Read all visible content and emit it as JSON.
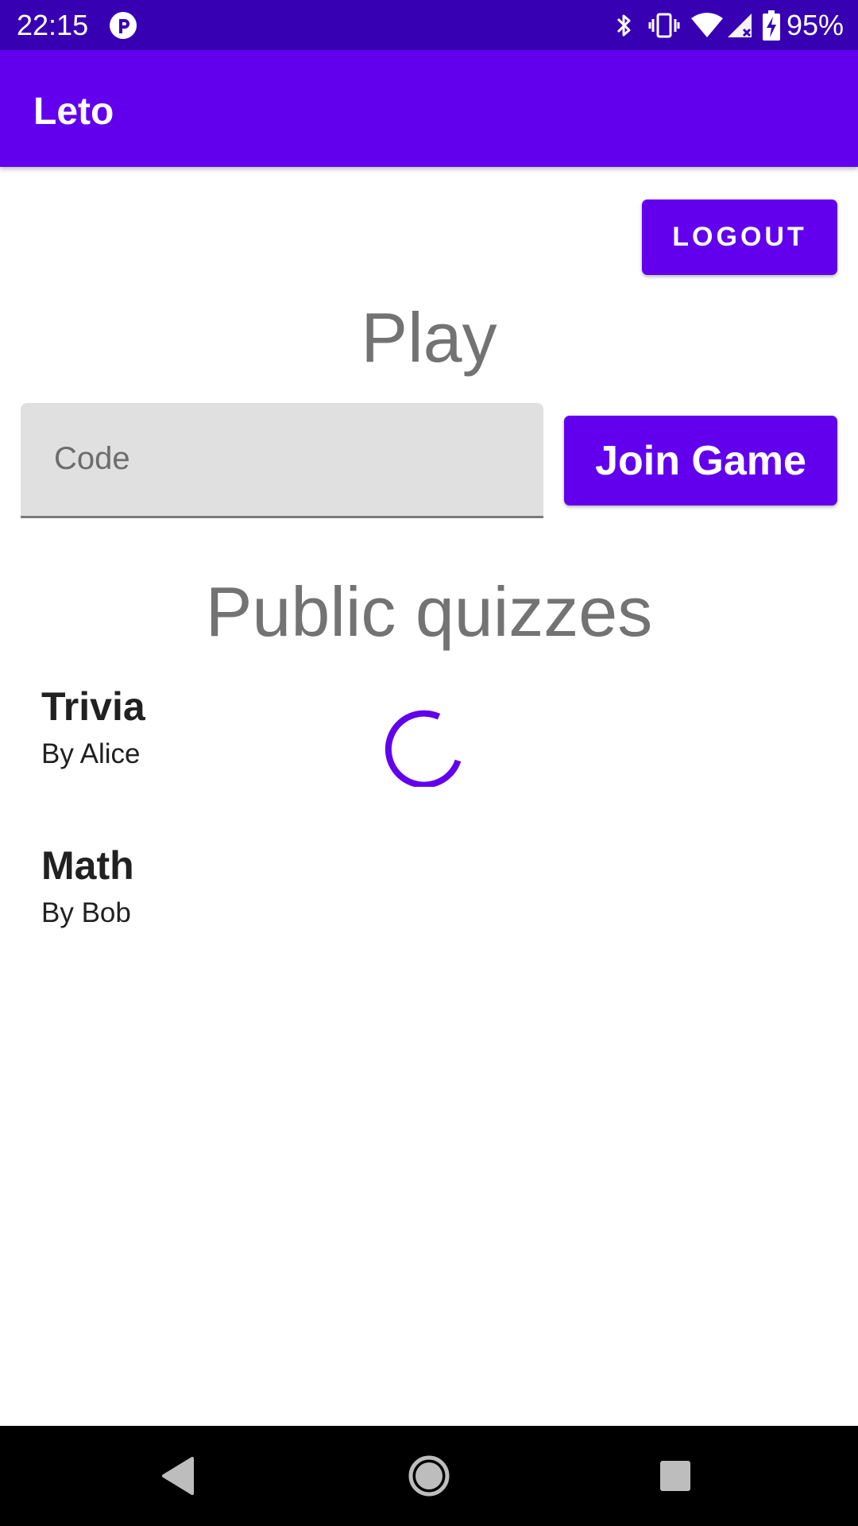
{
  "status_bar": {
    "time": "22:15",
    "battery": "95%",
    "icons": [
      "app-notification-icon",
      "bluetooth-icon",
      "vibrate-icon",
      "wifi-icon",
      "signal-icon",
      "battery-charging-icon"
    ]
  },
  "app_bar": {
    "title": "Leto"
  },
  "actions": {
    "logout_label": "LOGOUT"
  },
  "play": {
    "heading": "Play",
    "code_placeholder": "Code",
    "code_value": "",
    "join_label": "Join Game"
  },
  "public_quizzes": {
    "heading": "Public quizzes",
    "items": [
      {
        "title": "Trivia",
        "author": "By Alice"
      },
      {
        "title": "Math",
        "author": "By Bob"
      }
    ]
  },
  "nav_bar": {
    "icons": [
      "back-icon",
      "home-icon",
      "recents-icon"
    ]
  },
  "colors": {
    "status_bar": "#3700b3",
    "primary": "#6200ee",
    "heading_text": "#737373",
    "body_text": "#212121"
  }
}
